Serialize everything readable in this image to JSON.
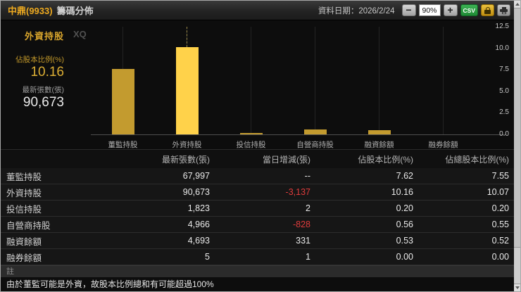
{
  "window": {
    "title_symbol": "中鼎(9933)",
    "title_rest": "籌碼分佈",
    "date_label": "資料日期：2026/2/24",
    "minus_label": "−",
    "zoom_value": "90%",
    "plus_label": "+",
    "csv_label": "CSV"
  },
  "info_panel": {
    "hover_name": "外資持股",
    "ratio_label": "佔股本比例(%)",
    "ratio_value": "10.16",
    "shares_label": "最新張數(張)",
    "shares_value": "90,673",
    "watermark": "XQ"
  },
  "chart_data": {
    "type": "bar",
    "categories": [
      "董監持股",
      "外資持股",
      "投信持股",
      "自營商持股",
      "融資餘額",
      "融券餘額"
    ],
    "values": [
      7.62,
      10.16,
      0.2,
      0.56,
      0.53,
      0.0
    ],
    "selected_index": 1,
    "ylabel": "佔股本比例(%)",
    "ylim": [
      0,
      12.5
    ],
    "yticks": [
      12.5,
      10.0,
      7.5,
      5.0,
      2.5,
      0.0
    ],
    "grid": "faint vertical line at each category center",
    "legend_position": "none",
    "bar_color": "#c39b2f",
    "selected_bar_color": "#ffd24a"
  },
  "table": {
    "headers": [
      "",
      "最新張數(張)",
      "當日增減(張)",
      "佔股本比例(%)",
      "佔總股本比例(%)"
    ],
    "rows": [
      {
        "label": "董監持股",
        "latest": "67,997",
        "change": "--",
        "change_negative": false,
        "ratio": "7.62",
        "total_ratio": "7.55"
      },
      {
        "label": "外資持股",
        "latest": "90,673",
        "change": "-3,137",
        "change_negative": true,
        "ratio": "10.16",
        "total_ratio": "10.07"
      },
      {
        "label": "投信持股",
        "latest": "1,823",
        "change": "2",
        "change_negative": false,
        "ratio": "0.20",
        "total_ratio": "0.20"
      },
      {
        "label": "自營商持股",
        "latest": "4,966",
        "change": "-828",
        "change_negative": true,
        "ratio": "0.56",
        "total_ratio": "0.55"
      },
      {
        "label": "融資餘額",
        "latest": "4,693",
        "change": "331",
        "change_negative": false,
        "ratio": "0.53",
        "total_ratio": "0.52"
      },
      {
        "label": "融券餘額",
        "latest": "5",
        "change": "1",
        "change_negative": false,
        "ratio": "0.00",
        "total_ratio": "0.00"
      }
    ]
  },
  "note": {
    "header": "註",
    "text": "由於董監可能是外資，故股本比例總和有可能超過100%"
  },
  "colors": {
    "accent_yellow": "#eca920",
    "bar_normal": "#c39b2f",
    "bar_selected": "#ffd24a",
    "negative_red": "#e03c3c",
    "csv_green": "#2fa044",
    "lock_gold": "#d6a51c"
  }
}
